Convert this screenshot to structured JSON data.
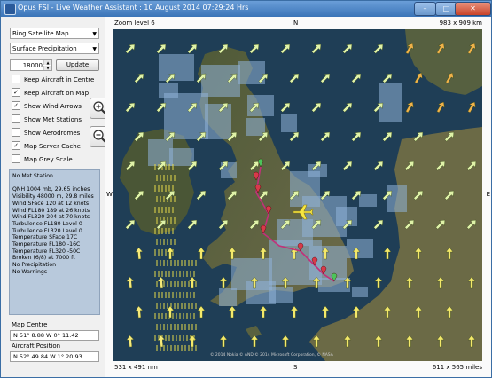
{
  "window": {
    "title": "Opus FSI - Live Weather Assistant : 10 August 2014  07:29:24 Hrs",
    "minimize": "–",
    "maximize": "□",
    "close": "✕"
  },
  "controls": {
    "map_type": "Bing Satellite Map",
    "layer": "Surface Precipitation",
    "altitude": "18000",
    "update_button": "Update"
  },
  "checkboxes": [
    {
      "label": "Keep Aircraft in Centre",
      "checked": false
    },
    {
      "label": "Keep Aircraft on Map",
      "checked": true
    },
    {
      "label": "Show Wind Arrows",
      "checked": true
    },
    {
      "label": "Show Met Stations",
      "checked": false
    },
    {
      "label": "Show Aerodromes",
      "checked": false
    },
    {
      "label": "Map Server Cache",
      "checked": true
    },
    {
      "label": "Map Grey Scale",
      "checked": false
    }
  ],
  "info": {
    "lines": [
      "No Met Station",
      "",
      "QNH 1004 mb, 29.65 inches",
      "Visibility 48000 m, 29.8 miles",
      "Wind SFace 120 at 12 knots",
      "Wind FL180 189 at 26 knots",
      "Wind FL320 204 at 70 knots",
      "Turbulence FL180 Level 0",
      "Turbulence FL320 Level 0",
      "Temperature SFace 17C",
      "Temperature FL180 -16C",
      "Temperature FL320 -50C",
      "Broken (6/8) at 7000 ft",
      "No Precipitation",
      "No Warnings"
    ]
  },
  "positions": {
    "map_centre_label": "Map Centre",
    "map_centre_value": "N 51° 8.88  W 0° 11.42",
    "aircraft_label": "Aircraft Position",
    "aircraft_value": "N 52° 49.84  W 1° 20.93"
  },
  "map": {
    "zoom_label": "Zoom level 6",
    "top_size": "983 x 909 km",
    "bottom_left_size": "531 x 491 nm",
    "bottom_right_size": "611 x 565 miles",
    "compass": {
      "n": "N",
      "s": "S",
      "e": "E",
      "w": "W"
    },
    "attribution": "© 2014 Nokia © AND © 2014 Microsoft Corporation, © NASA"
  },
  "colors": {
    "sea": "#1f3e56",
    "precip": "#8fb3d9",
    "route": "#c2307a",
    "aircraft": "#f7e642"
  }
}
